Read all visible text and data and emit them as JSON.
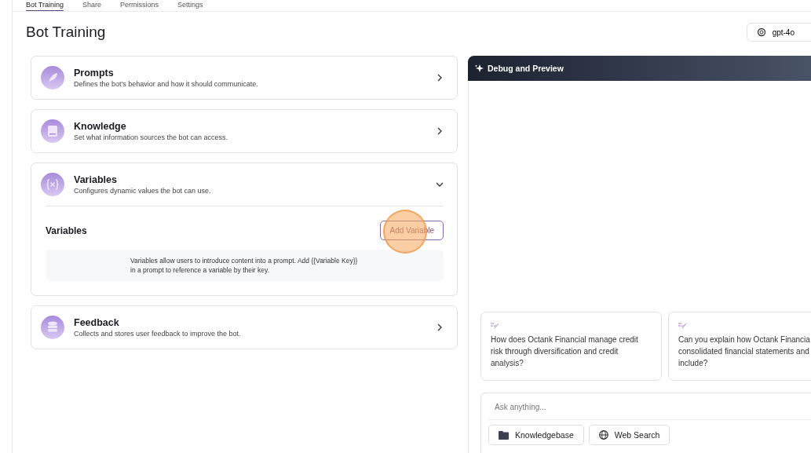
{
  "tabs": [
    {
      "label": "Bot Training",
      "selected": true
    },
    {
      "label": "Share",
      "selected": false
    },
    {
      "label": "Permissions",
      "selected": false
    },
    {
      "label": "Settings",
      "selected": false
    }
  ],
  "page_title": "Bot Training",
  "model_selector": {
    "value": "gpt-4o"
  },
  "sections": [
    {
      "kind": "prompts",
      "title": "Prompts",
      "description": "Defines the bot's behavior and how it should communicate.",
      "expanded": false
    },
    {
      "kind": "knowledge",
      "title": "Knowledge",
      "description": "Set what information sources the bot can access.",
      "expanded": false
    },
    {
      "kind": "variables",
      "title": "Variables",
      "description": "Configures dynamic values the bot can use.",
      "expanded": true,
      "body": {
        "heading": "Variables",
        "button": "Add Variable",
        "info": "Variables allow users to introduce content into a prompt. Add {{Variable Key}} in a prompt to reference a variable by their key."
      }
    },
    {
      "kind": "feedback",
      "title": "Feedback",
      "description": "Collects and stores user feedback to improve the bot.",
      "expanded": false
    }
  ],
  "preview": {
    "title": "Debug and Preview",
    "suggestions": [
      {
        "lines": [
          "How does Octank Financial manage credit",
          "risk through diversification and credit",
          "analysis?"
        ]
      },
      {
        "lines": [
          "Can you explain how Octank Financia",
          "consolidated financial statements and",
          "include?"
        ]
      }
    ],
    "input": {
      "placeholder": "Ask anything..."
    },
    "tools": [
      {
        "kind": "folder",
        "label": "Knowledgebase"
      },
      {
        "kind": "globe",
        "label": "Web Search"
      }
    ]
  }
}
